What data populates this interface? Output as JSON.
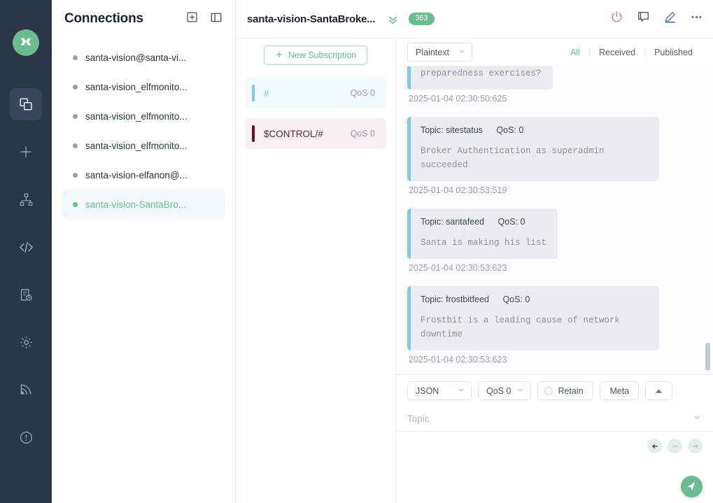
{
  "app": {
    "logo_icon": "mqttx-logo-icon"
  },
  "rail": {
    "items": [
      {
        "icon": "connections-icon",
        "name": "connections",
        "active": true
      },
      {
        "icon": "plus-icon",
        "name": "new-connection",
        "active": false
      },
      {
        "icon": "sitemap-icon",
        "name": "topic-tree",
        "active": false
      },
      {
        "icon": "code-icon",
        "name": "scripts",
        "active": false
      },
      {
        "icon": "log-clock-icon",
        "name": "log",
        "active": false
      },
      {
        "icon": "gear-icon",
        "name": "settings",
        "active": false
      },
      {
        "icon": "broadcast-icon",
        "name": "benchmark",
        "active": false
      },
      {
        "icon": "info-circle-icon",
        "name": "about",
        "active": false
      }
    ]
  },
  "connections": {
    "title": "Connections",
    "new_icon": "plus-box-icon",
    "panel_toggle_icon": "panel-layout-icon",
    "items": [
      {
        "label": "santa-vision@santa-vi...",
        "active": false
      },
      {
        "label": "santa-vision_elfmonito...",
        "active": false
      },
      {
        "label": "santa-vision_elfmonito...",
        "active": false
      },
      {
        "label": "santa-vision_elfmonito...",
        "active": false
      },
      {
        "label": "santa-vision-elfanon@...",
        "active": false
      },
      {
        "label": "santa-vision-SantaBro...",
        "active": true
      }
    ]
  },
  "topbar": {
    "title": "santa-vision-SantaBroke...",
    "chevron_icon": "double-chevron-down-icon",
    "badge": "363",
    "icons": [
      {
        "name": "disconnect-power-icon",
        "color": "#ee6a6a"
      },
      {
        "name": "chat-bubble-icon",
        "color": "#3f4c5e"
      },
      {
        "name": "edit-pencil-icon",
        "color": "#3d6ebd"
      },
      {
        "name": "more-dots-icon",
        "color": "#3f4c5e"
      }
    ]
  },
  "subscriptions": {
    "new_button": "New Subscription",
    "new_button_icon": "plus-icon",
    "items": [
      {
        "topic": "#",
        "qos": "QoS 0",
        "bar_color": "#7fcbdd",
        "bg": "#f2fafb",
        "text_color": "#7fcbdd"
      },
      {
        "topic": "$CONTROL/#",
        "qos": "QoS 0",
        "bar_color": "#6d1022",
        "bg": "#f8f0f2",
        "text_color": "#5f2730"
      }
    ]
  },
  "messages": {
    "format": "Plaintext",
    "format_caret_icon": "chevron-down-icon",
    "filters": [
      {
        "label": "All",
        "active": true
      },
      {
        "label": "Received",
        "active": false
      },
      {
        "label": "Published",
        "active": false
      }
    ],
    "list": [
      {
        "clipped": true,
        "topic": "",
        "qos": "",
        "payload": "preparedness exercises?",
        "time": "2025-01-04 02:30:50:625"
      },
      {
        "clipped": false,
        "topic": "Topic: sitestatus",
        "qos": "QoS: 0",
        "payload": "Broker Authentication as superadmin succeeded",
        "time": "2025-01-04 02:30:53:519"
      },
      {
        "clipped": false,
        "topic": "Topic: santafeed",
        "qos": "QoS: 0",
        "payload": "Santa is making his list",
        "time": "2025-01-04 02:30:53:623"
      },
      {
        "clipped": false,
        "topic": "Topic: frostbitfeed",
        "qos": "QoS: 0",
        "payload": "Frostbit is a leading cause of network downtime",
        "time": "2025-01-04 02:30:53:623"
      }
    ]
  },
  "publish": {
    "payload_format": "JSON",
    "qos": "QoS 0",
    "retain_label": "Retain",
    "retain_checked": false,
    "meta_label": "Meta",
    "collapse_icon": "caret-up-icon",
    "topic_placeholder": "Topic",
    "topic_value": "",
    "topic_caret_icon": "chevron-down-icon",
    "payload_value": "",
    "nav": [
      {
        "icon": "arrow-left-icon",
        "enabled": true
      },
      {
        "icon": "dash-icon",
        "enabled": false
      },
      {
        "icon": "arrow-right-icon",
        "enabled": false
      }
    ],
    "send_icon": "send-paper-plane-icon"
  },
  "colors": {
    "brand_green": "#6cbc92",
    "rail_bg": "#2b3647",
    "accent_blue": "#7fcbdd"
  }
}
